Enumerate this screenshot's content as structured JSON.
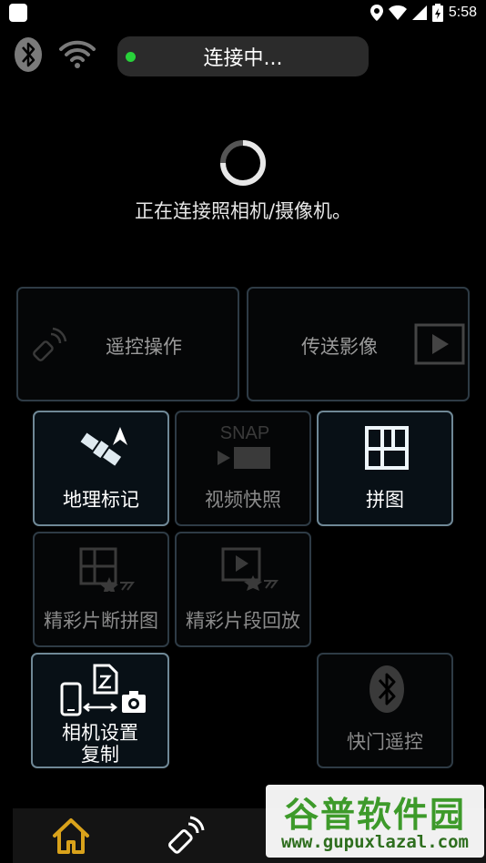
{
  "status_bar": {
    "time": "5:58"
  },
  "connection": {
    "status_label": "连接中...",
    "message": "正在连接照相机/摄像机。"
  },
  "tiles": {
    "remote": "遥控操作",
    "transfer": "传送影像",
    "geotag": "地理标记",
    "snap_movie": "视频快照",
    "snap_icon_text": "SNAP",
    "collage": "拼图",
    "highlight_collage": "精彩片断拼图",
    "highlight_playback": "精彩片段回放",
    "copy_settings_line1": "相机设置",
    "copy_settings_line2": "复制",
    "shutter_remote": "快门遥控"
  },
  "watermark": {
    "title": "谷普软件园",
    "url": "www.gupuxlazal.com"
  },
  "colors": {
    "accent_green": "#28d23a",
    "home_gold": "#d9a21b"
  }
}
